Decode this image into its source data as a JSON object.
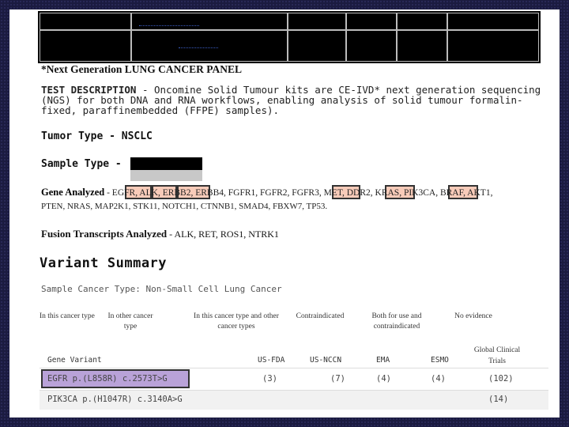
{
  "document": {
    "panel_title": "*Next Generation LUNG CANCER PANEL",
    "test_description_label": "TEST DESCRIPTION",
    "test_description_text": " - Oncomine Solid Tumour kits are CE-IVD* next generation sequencing (NGS) for both DNA and RNA workflows, enabling analysis of solid tumour formalin-fixed, paraffinembedded (FFPE) samples).",
    "tumor_type": "Tumor Type - NSCLC",
    "sample_type": "Sample Type -",
    "gene_analyzed_label": "Gene Analyzed",
    "genes_line1": " - EGFR, ALK, ERBB2, ERBB4, FGFR1, FGFR2, FGFR3, MET, DDR2, KRAS, PIK3CA, BRAF, AKT1,",
    "genes_line2": "PTEN, NRAS, MAP2K1, STK11, NOTCH1, CTNNB1, SMAD4, FBXW7, TP53.",
    "fusion_label": "Fusion Transcripts Analyzed",
    "fusion_genes": " - ALK, RET, ROS1, NTRK1",
    "variant_summary_title": "Variant Summary",
    "sample_cancer_type": "Sample Cancer Type: Non-Small Cell Lung Cancer"
  },
  "legend": [
    "In this cancer type",
    "In other cancer type",
    "In this cancer type and other cancer types",
    "Contraindicated",
    "Both for use and contraindicated",
    "No evidence"
  ],
  "table": {
    "headers": [
      "Gene Variant",
      "US-FDA",
      "US-NCCN",
      "EMA",
      "ESMO",
      "Global Clinical Trials"
    ],
    "rows": [
      {
        "variant": "EGFR p.(L858R) c.2573T>G",
        "us_fda": "(3)",
        "us_nccn": "(7)",
        "ema": "(4)",
        "esmo": "(4)",
        "trials": "(102)"
      },
      {
        "variant": "PIK3CA p.(H1047R) c.3140A>G",
        "us_fda": "",
        "us_nccn": "",
        "ema": "",
        "esmo": "",
        "trials": "(14)"
      }
    ]
  },
  "colors": {
    "gene_highlight": "#f08c64",
    "row_highlight": "#b9a2d8",
    "border_background": "#1b1b40"
  }
}
